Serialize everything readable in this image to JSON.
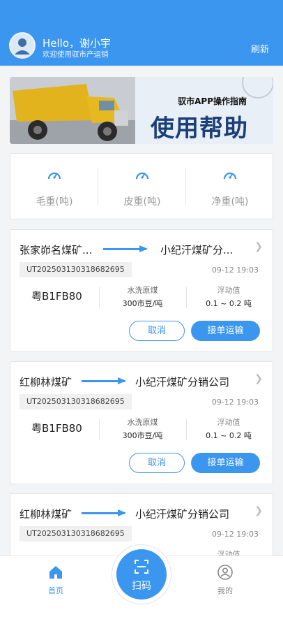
{
  "header": {
    "greeting": "Hello，谢小宇",
    "welcome": "欢迎使用驭市产运销",
    "refresh_label": "刷新"
  },
  "banner": {
    "subtitle": "驭市APP操作指南",
    "title": "使用帮助"
  },
  "weights": {
    "items": [
      {
        "label": "毛重(吨)",
        "icon": "gauge-icon"
      },
      {
        "label": "皮重(吨)",
        "icon": "gauge-icon"
      },
      {
        "label": "净重(吨)",
        "icon": "gauge-icon"
      }
    ]
  },
  "orders": [
    {
      "from": "张家峁名煤矿...",
      "to": "小纪汗煤矿分...",
      "code": "UT202503130318682695",
      "datetime": "09-12 19:03",
      "plate": "粤B1FB80",
      "cargo": "水洗原煤",
      "price": "300市豆/吨",
      "float_label": "浮动值",
      "float_value": "0.1 ~ 0.2 吨",
      "cancel_label": "取消",
      "accept_label": "接单运输"
    },
    {
      "from": "红柳林煤矿",
      "to": "小纪汗煤矿分销公司",
      "code": "UT202503130318682695",
      "datetime": "09-12 19:03",
      "plate": "粤B1FB80",
      "cargo": "水洗原煤",
      "price": "300市豆/吨",
      "float_label": "浮动值",
      "float_value": "0.1 ~ 0.2 吨",
      "cancel_label": "取消",
      "accept_label": "接单运输"
    },
    {
      "from": "红柳林煤矿",
      "to": "小纪汗煤矿分销公司",
      "code": "UT202503130318682695",
      "datetime": "09-12 19:03",
      "float_label": "浮动值"
    }
  ],
  "nav": {
    "home_label": "首页",
    "scan_label": "扫码",
    "mine_label": "我的"
  },
  "colors": {
    "primary": "#3b96f0",
    "background": "#f3f4f6"
  }
}
